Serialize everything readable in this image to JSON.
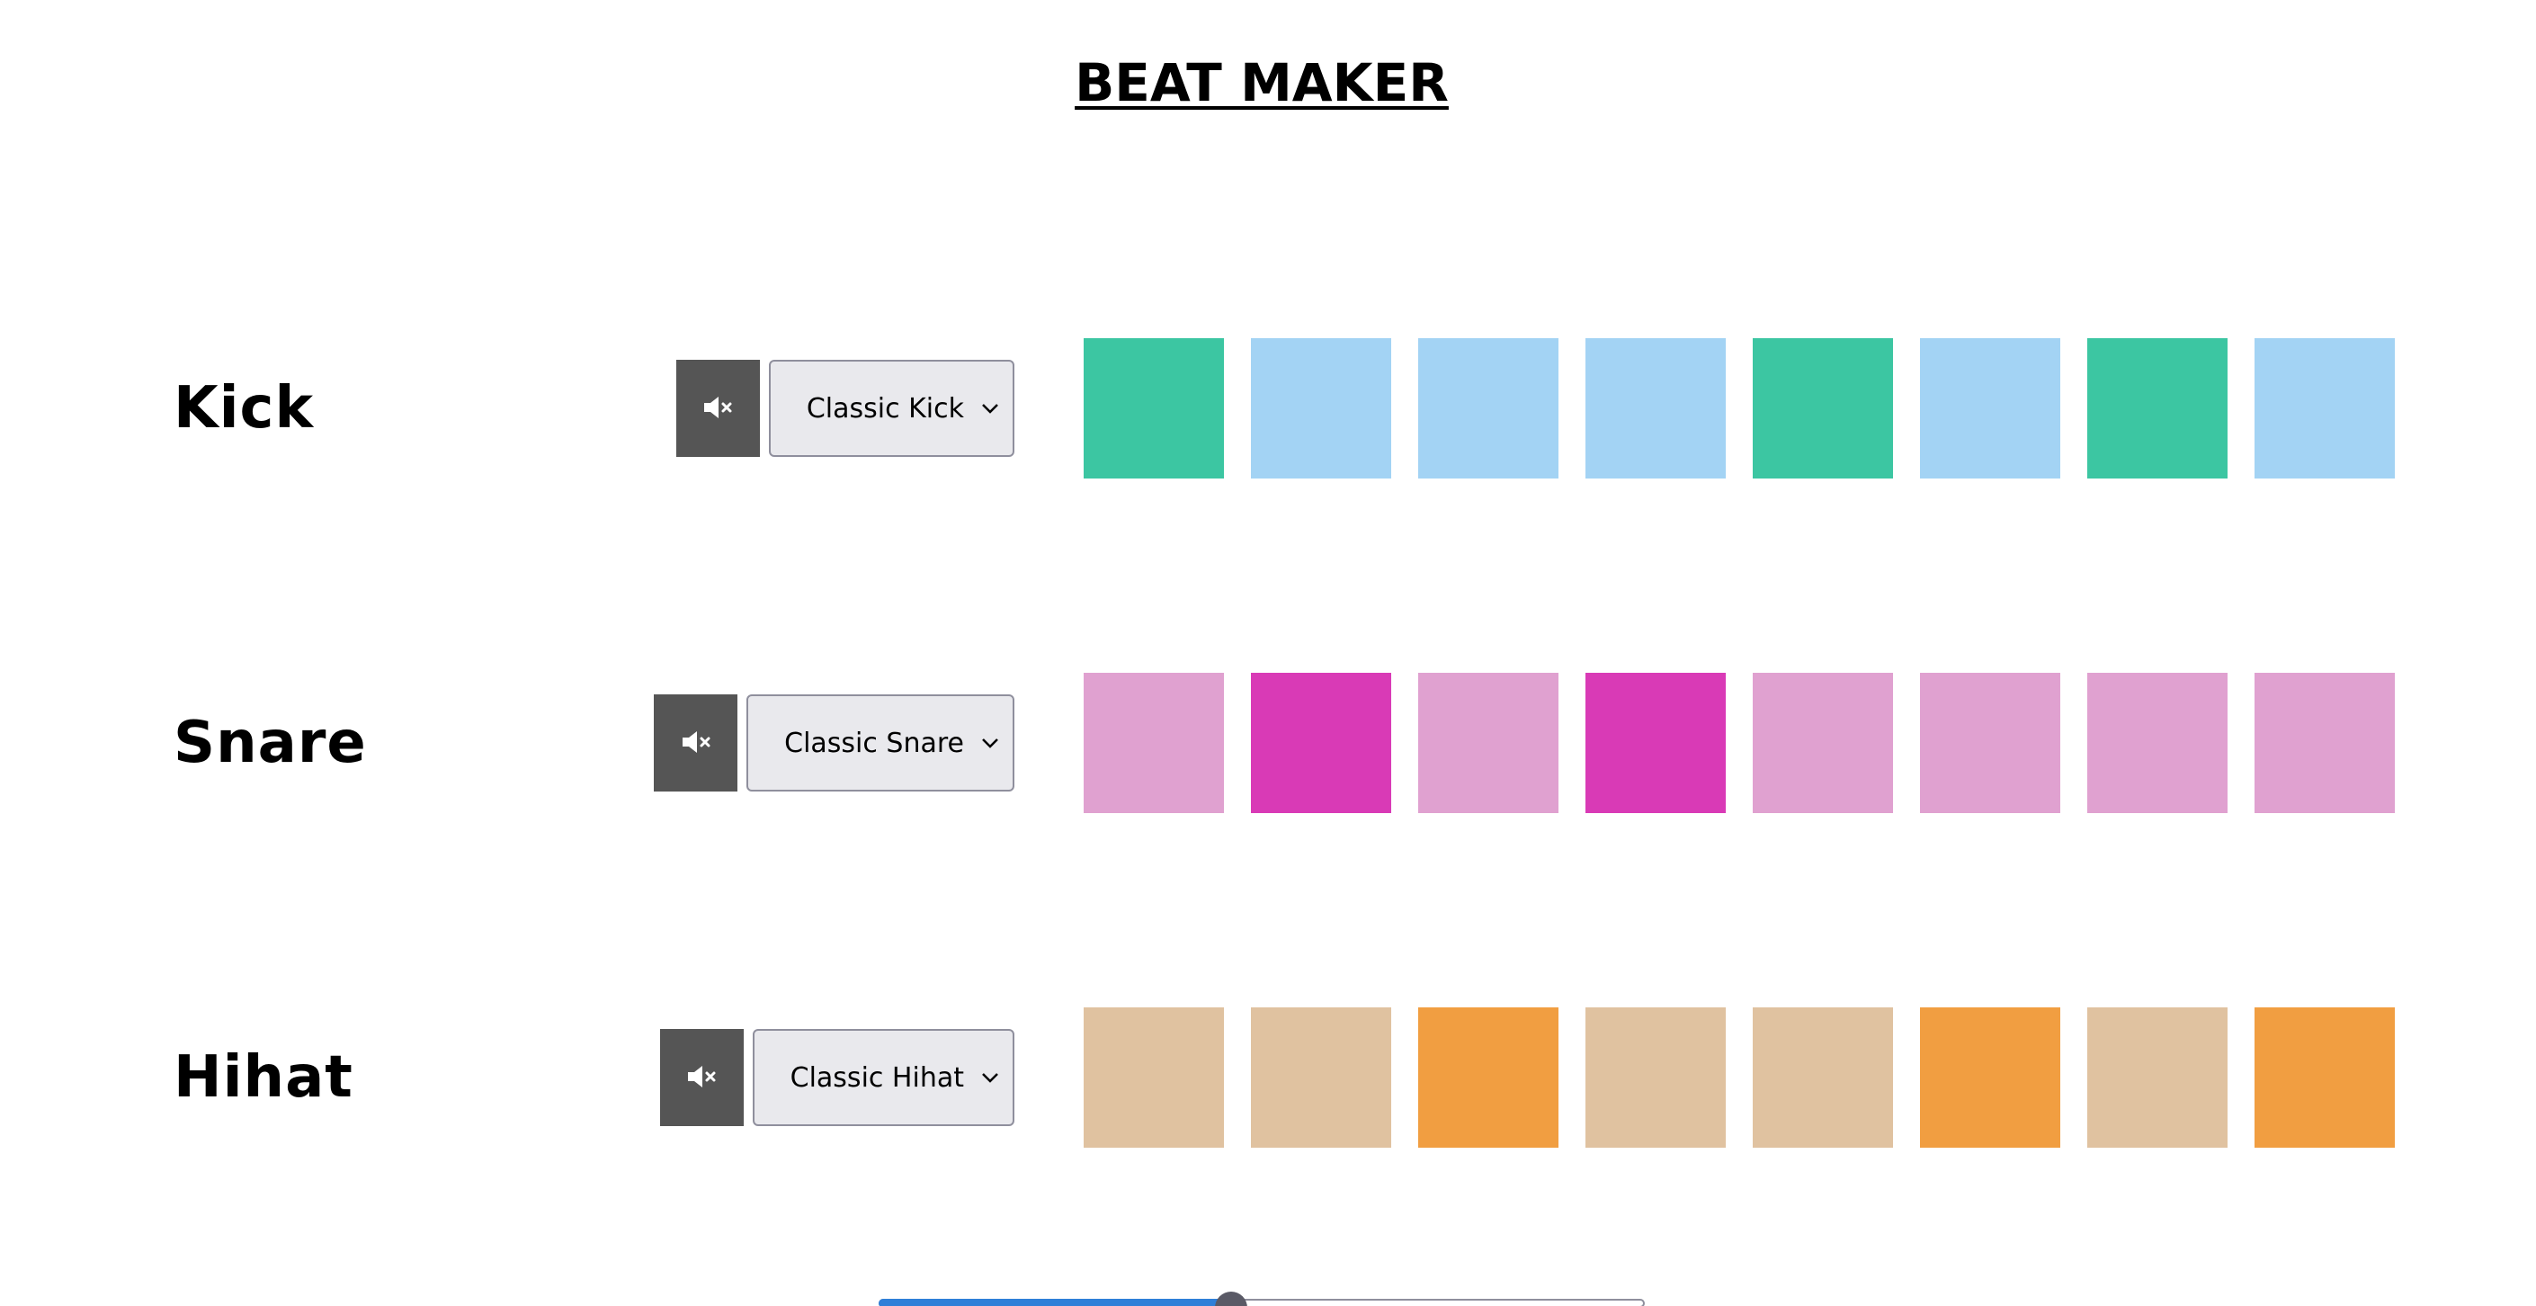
{
  "app": {
    "title": "BEAT MAKER"
  },
  "colors": {
    "mute_button_bg": "#555555",
    "kick_active": "#3cc6a2",
    "kick_inactive": "#a3d3f4",
    "snare_active": "#d93ab6",
    "snare_inactive": "#e0a1d0",
    "hihat_active": "#f19e41",
    "hihat_inactive": "#e0c2a0",
    "slider_fill": "#2f7fd8"
  },
  "tracks": [
    {
      "name": "Kick",
      "mute_icon": "speaker-mute-icon",
      "sound_selected": "Classic Kick",
      "pads": [
        true,
        false,
        false,
        false,
        true,
        false,
        true,
        false
      ],
      "active_color": "#3cc6a2",
      "inactive_color": "#a3d3f4"
    },
    {
      "name": "Snare",
      "mute_icon": "speaker-mute-icon",
      "sound_selected": "Classic Snare",
      "pads": [
        false,
        true,
        false,
        true,
        false,
        false,
        false,
        false
      ],
      "active_color": "#d93ab6",
      "inactive_color": "#e0a1d0"
    },
    {
      "name": "Hihat",
      "mute_icon": "speaker-mute-icon",
      "sound_selected": "Classic Hihat",
      "pads": [
        false,
        false,
        true,
        false,
        false,
        true,
        false,
        true
      ],
      "active_color": "#f19e41",
      "inactive_color": "#e0c2a0"
    }
  ],
  "tempo_slider": {
    "fraction": 0.46
  }
}
